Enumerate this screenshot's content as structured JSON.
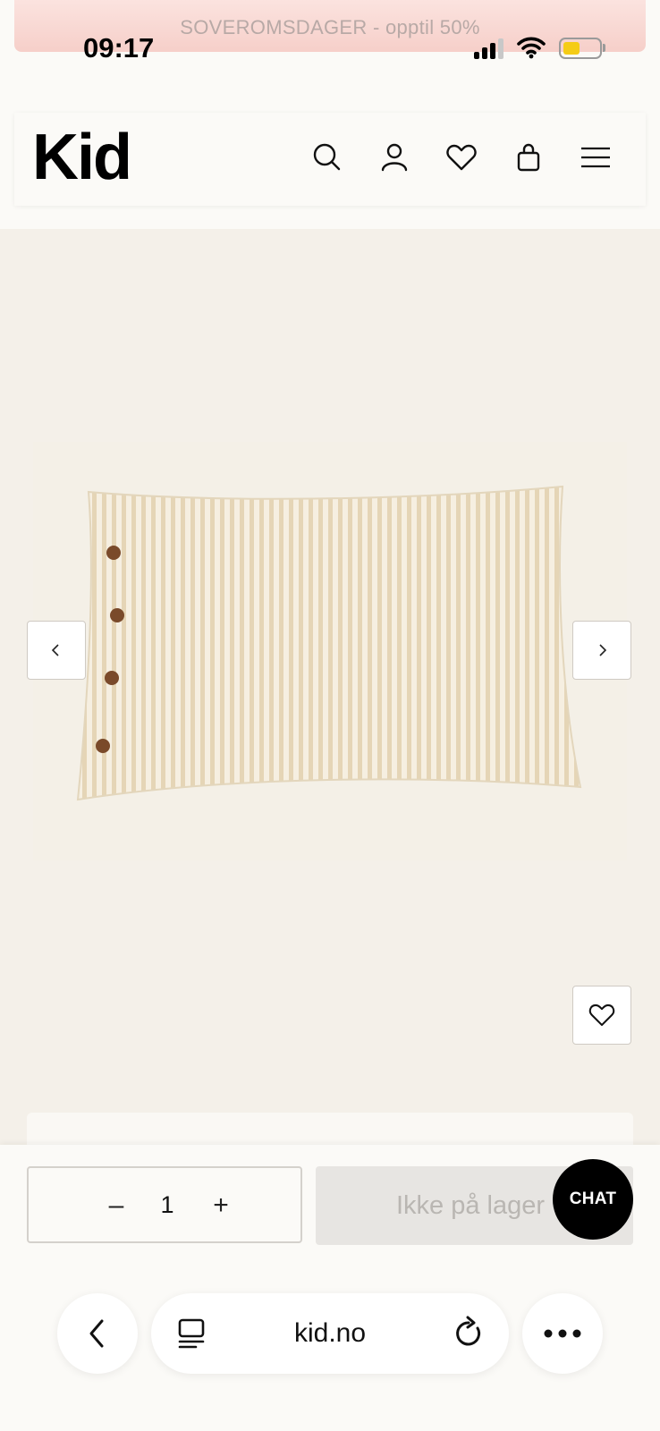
{
  "status_bar": {
    "time": "09:17",
    "signal_icon": "signal-icon",
    "wifi_icon": "wifi-icon",
    "battery_icon": "battery-icon",
    "battery_color": "#f5cc16"
  },
  "promo_banner": {
    "text": "SOVEROMSDAGER - opptil 50%"
  },
  "header": {
    "logo": "Kid",
    "icons": [
      "search-icon",
      "account-icon",
      "wishlist-heart-icon",
      "cart-bag-icon",
      "menu-hamburger-icon"
    ]
  },
  "gallery": {
    "image_description_name": "striped-pillow-product-image",
    "prev_icon": "chevron-left-icon",
    "next_icon": "chevron-right-icon",
    "favorite_icon": "heart-icon"
  },
  "purchase": {
    "quantity": "1",
    "minus_label": "–",
    "plus_label": "+",
    "stock_label": "Ikke på lager",
    "chat_label": "CHAT"
  },
  "browser": {
    "url": "kid.no",
    "back_icon": "back-arrow-icon",
    "tabs_icon": "tabs-icon",
    "reload_icon": "reload-icon",
    "more_icon": "more-dots-icon"
  },
  "colors": {
    "page_bg": "#f4f0e9",
    "accent": "#000000",
    "promo_bg": "#f6cfc9"
  }
}
